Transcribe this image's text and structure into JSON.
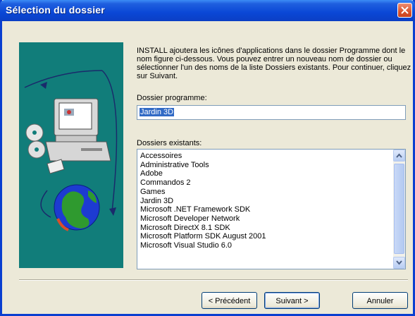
{
  "window": {
    "title": "Sélection du dossier"
  },
  "intro_text": "INSTALL ajoutera les icônes d'applications dans le dossier Programme dont le nom figure ci-dessous. Vous pouvez entrer un nouveau nom de dossier ou sélectionner l'un des noms de la liste Dossiers existants. Pour continuer, cliquez sur Suivant.",
  "program_folder": {
    "label": "Dossier programme:",
    "value": "Jardin 3D"
  },
  "existing_folders": {
    "label": "Dossiers existants:",
    "items": [
      "Accessoires",
      "Administrative Tools",
      "Adobe",
      "Commandos 2",
      "Games",
      "Jardin 3D",
      "Microsoft .NET Framework SDK",
      "Microsoft Developer Network",
      "Microsoft DirectX 8.1 SDK",
      "Microsoft Platform SDK August 2001",
      "Microsoft Visual Studio 6.0"
    ]
  },
  "buttons": {
    "previous": "< Précédent",
    "next": "Suivant >",
    "cancel": "Annuler"
  },
  "colors": {
    "titlebar": "#0a47d6",
    "art_background": "#117d7a",
    "selection": "#316ac5"
  }
}
